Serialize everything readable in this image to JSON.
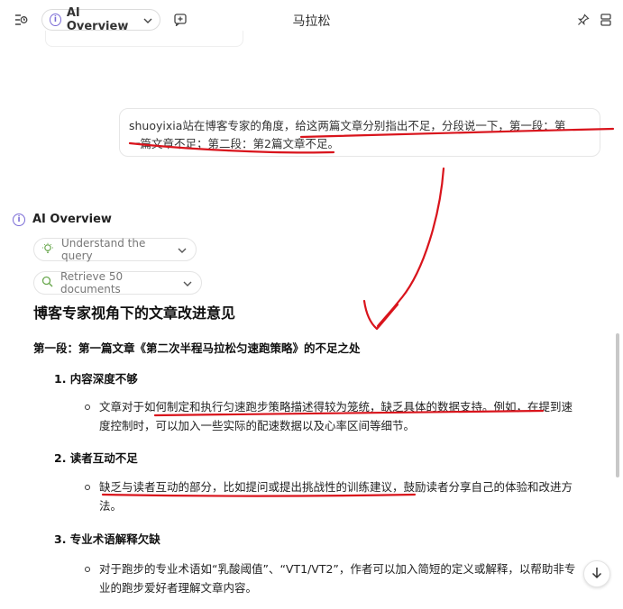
{
  "toolbar": {
    "mode_label": "AI Overview",
    "title": "马拉松"
  },
  "user_message": {
    "line1": "shuoyixia站在博客专家的角度，给这两篇文章分别指出不足，分段说一下，第一段：第",
    "line2": "一篇文章不足；第二段：第2篇文章不足。"
  },
  "overview": {
    "header": "AI Overview",
    "steps": [
      {
        "label": "Understand the query",
        "icon": "lightbulb-icon"
      },
      {
        "label": "Retrieve 50 documents",
        "icon": "search-icon"
      }
    ],
    "heading": "博客专家视角下的文章改进意见",
    "section1": "第一段：第一篇文章《第二次半程马拉松匀速跑策略》的不足之处",
    "items": [
      {
        "title": "1. 内容深度不够",
        "bullet_line1": "文章对于如何制定和执行匀速跑步策略描述得较为笼统，缺乏具体的数据支持。例如，在提到速",
        "bullet_line2": "度控制时，可以加入一些实际的配速数据以及心率区间等细节。"
      },
      {
        "title": "2. 读者互动不足",
        "bullet_line1": "缺乏与读者互动的部分，比如提问或提出挑战性的训练建议，鼓励读者分享自己的体验和改进方",
        "bullet_line2": "法。"
      },
      {
        "title": "3. 专业术语解释欠缺",
        "bullet_line1": "对于跑步的专业术语如“乳酸阈值”、“VT1/VT2”，作者可以加入简短的定义或解释，以帮助非专",
        "bullet_line2": "业的跑步爱好者理解文章内容。"
      }
    ]
  },
  "colors": {
    "ink": "#d9141c",
    "accent": "#7a6bd6"
  }
}
